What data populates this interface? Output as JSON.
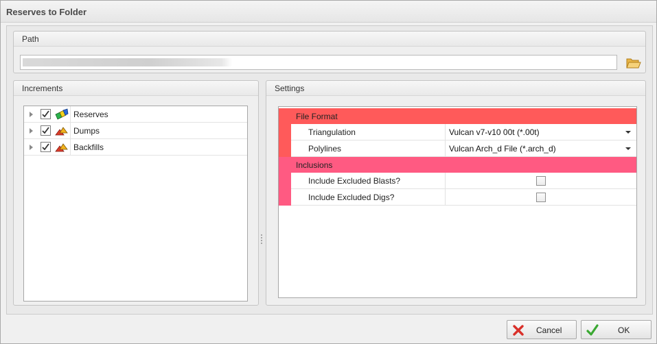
{
  "window": {
    "title": "Reserves to Folder"
  },
  "path_group": {
    "header": "Path",
    "value": "",
    "browse_icon": "folder-open-icon"
  },
  "increments": {
    "header": "Increments",
    "items": [
      {
        "label": "Reserves",
        "checked": true,
        "icon": "reserves-icon"
      },
      {
        "label": "Dumps",
        "checked": true,
        "icon": "dumps-icon"
      },
      {
        "label": "Backfills",
        "checked": true,
        "icon": "backfills-icon"
      }
    ]
  },
  "settings": {
    "header": "Settings",
    "categories": [
      {
        "label": "File Format",
        "color": "#ff5a5a",
        "properties": [
          {
            "name": "Triangulation",
            "value": "Vulcan v7-v10 00t (*.00t)",
            "type": "dropdown"
          },
          {
            "name": "Polylines",
            "value": "Vulcan Arch_d File (*.arch_d)",
            "type": "dropdown"
          }
        ]
      },
      {
        "label": "Inclusions",
        "color": "#ff5a82",
        "properties": [
          {
            "name": "Include Excluded Blasts?",
            "checked": false,
            "type": "checkbox"
          },
          {
            "name": "Include Excluded Digs?",
            "checked": false,
            "type": "checkbox"
          }
        ]
      }
    ]
  },
  "buttons": {
    "cancel": "Cancel",
    "ok": "OK"
  }
}
